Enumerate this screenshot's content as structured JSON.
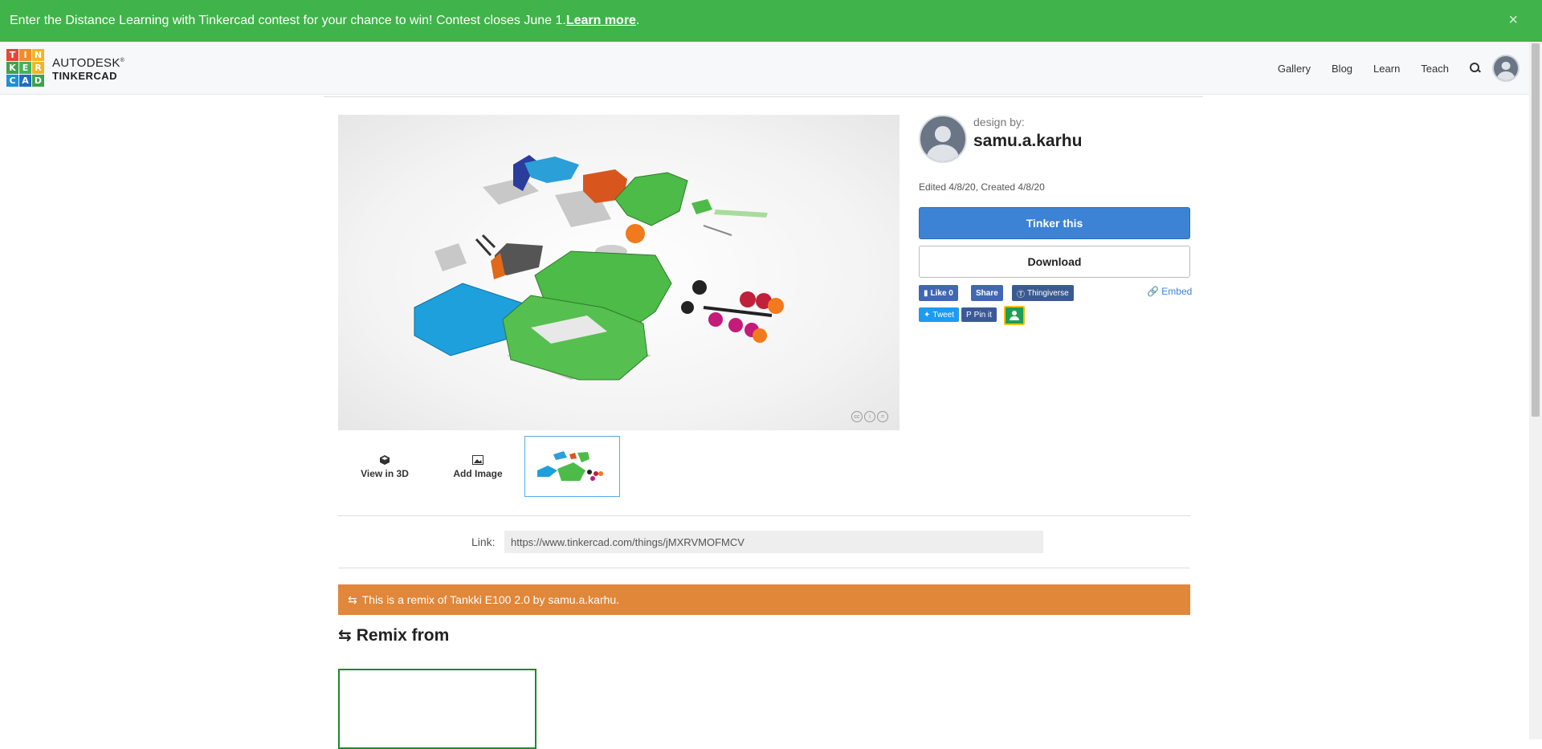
{
  "banner": {
    "text": "Enter the Distance Learning with Tinkercad contest for your chance to win! Contest closes June 1. ",
    "link": "Learn more",
    "period": ".",
    "close": "×"
  },
  "header": {
    "logo_letters": [
      "T",
      "I",
      "N",
      "K",
      "E",
      "R",
      "C",
      "A",
      "D"
    ],
    "logo_colors": [
      "#e2483a",
      "#f08c2a",
      "#f3b42b",
      "#3da34a",
      "#44b25c",
      "#f3b42b",
      "#1f8fd6",
      "#1d6fbd",
      "#3da34a"
    ],
    "logo_line1": "AUTODESK",
    "logo_reg": "®",
    "logo_line2": "TINKERCAD",
    "nav": [
      "Gallery",
      "Blog",
      "Learn",
      "Teach"
    ]
  },
  "design": {
    "design_by": "design by:",
    "designer": "samu.a.karhu",
    "edited": "Edited 4/8/20, Created 4/8/20",
    "tinker_label": "Tinker this",
    "download_label": "Download",
    "embed_label": "Embed",
    "social": {
      "like": "Like 0",
      "share": "Share",
      "thingiverse": "Thingiverse",
      "tweet": "Tweet",
      "pin": "Pin it"
    }
  },
  "thumbs": {
    "view3d": "View in 3D",
    "add_image": "Add Image"
  },
  "link": {
    "label": "Link:",
    "value": "https://www.tinkercad.com/things/jMXRVMOFMCV"
  },
  "remix": {
    "notice": "This is a remix of Tankki E100 2.0 by samu.a.karhu.",
    "heading": "Remix from"
  },
  "colors": {
    "banner": "#40b34a",
    "tinker_button": "#3c82d5",
    "remix_bar": "#e0873a",
    "remix_card_border": "#1c8a2c"
  }
}
